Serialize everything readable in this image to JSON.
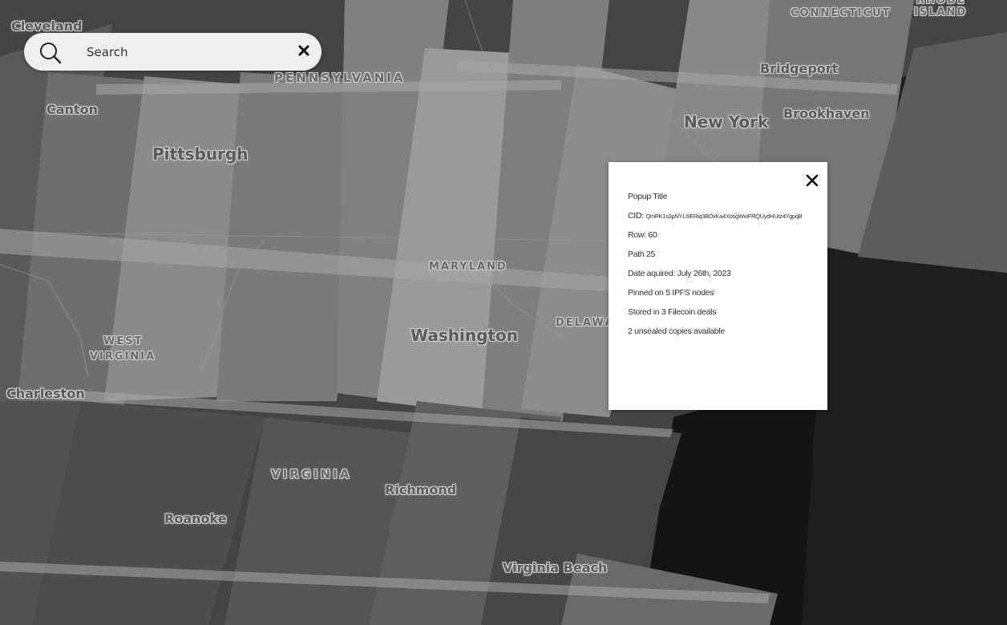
{
  "search": {
    "placeholder": "Search"
  },
  "places": {
    "cleveland": "Cleveland",
    "canton": "Canton",
    "pittsburgh": "Pittsburgh",
    "pennsylvania": "PENNSYLVANIA",
    "connecticut": "CONNECTICUT",
    "rhode_island_1": "RHODE",
    "rhode_island_2": "ISLAND",
    "bridgeport": "Bridgeport",
    "brookhaven": "Brookhaven",
    "new_york": "New York",
    "maryland": "MARYLAND",
    "delaware": "DELAWA",
    "washington": "Washington",
    "west_virginia_1": "WEST",
    "west_virginia_2": "VIRGINIA",
    "charleston": "Charleston",
    "virginia": "VIRGINIA",
    "richmond": "Richmond",
    "roanoke": "Roanoke",
    "virginia_beach": "Virginia Beach"
  },
  "popup": {
    "title": "Popup Title",
    "cid_label": "CID:",
    "cid_value": "QmPK1s3pNYLi9ERiq3BDxKa4XosgWwFRQUydHUtz4YgpqB",
    "row": "Row: 60",
    "path": "Path 25",
    "date": "Date aquired: July 26th, 2023",
    "pinned": "Pinned on 5 IPFS nodes",
    "stored": "Stored in 3 Filecoin deals",
    "copies": "2 unsealed copies available"
  },
  "icons": {
    "search": "search-icon",
    "clear": "close-icon",
    "popup_close": "close-icon"
  },
  "colors": {
    "map_background": "#3d3d3d",
    "popup_background": "#ffffff",
    "search_background": "#efefef"
  }
}
